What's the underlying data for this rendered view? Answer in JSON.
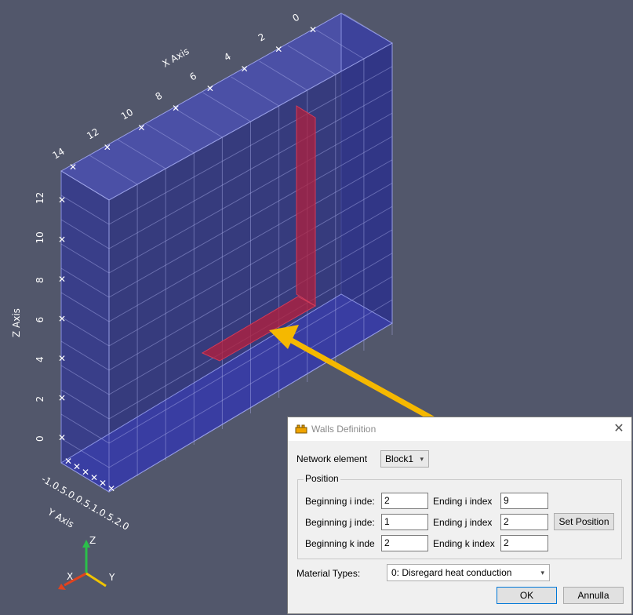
{
  "viewport": {
    "x_axis_title": "X Axis",
    "y_axis_title": "Y Axis",
    "z_axis_title": "Z Axis",
    "x_ticks": [
      "0",
      "2",
      "4",
      "6",
      "8",
      "10",
      "12",
      "14"
    ],
    "z_ticks": [
      "0",
      "2",
      "4",
      "6",
      "8",
      "10",
      "12"
    ],
    "y_ticks_overlap": "-1.0.5.0.0.5.1.0.5.2.0",
    "y_ticks_display": "-1.00.0.5.00.5.0.5.0",
    "orientation": {
      "x": "X",
      "y": "Y",
      "z": "Z"
    },
    "colors": {
      "background": "#52576b",
      "block": "#3c3f9c",
      "wall": "#a3203f",
      "arrow": "#f5b800"
    }
  },
  "dialog": {
    "title": "Walls Definition",
    "close_glyph": "✕",
    "network_element_label": "Network element",
    "network_element_value": "Block1",
    "position_group": "Position",
    "beginning_i_label": "Beginning i inde:",
    "beginning_i_value": "2",
    "ending_i_label": "Ending i index",
    "ending_i_value": "9",
    "beginning_j_label": "Beginning j inde:",
    "beginning_j_value": "1",
    "ending_j_label": "Ending j index",
    "ending_j_value": "2",
    "set_position_label": "Set Position",
    "beginning_k_label": "Beginning k inde",
    "beginning_k_value": "2",
    "ending_k_label": "Ending k index",
    "ending_k_value": "2",
    "material_types_label": "Material Types:",
    "material_types_value": "0: Disregard heat conduction",
    "ok_label": "OK",
    "cancel_label": "Annulla"
  }
}
